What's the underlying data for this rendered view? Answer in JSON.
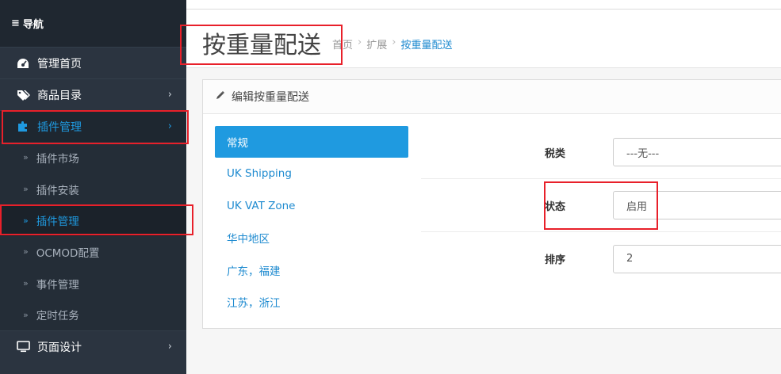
{
  "sidebar": {
    "nav_title": "导航",
    "items": [
      {
        "label": "管理首页",
        "icon": "dashboard-icon"
      },
      {
        "label": "商品目录",
        "icon": "tags-icon"
      },
      {
        "label": "插件管理",
        "icon": "puzzle-icon"
      }
    ],
    "sub_items": [
      {
        "label": "插件市场"
      },
      {
        "label": "插件安装"
      },
      {
        "label": "插件管理"
      },
      {
        "label": "OCMOD配置"
      },
      {
        "label": "事件管理"
      },
      {
        "label": "定时任务"
      }
    ],
    "bottom_item": {
      "label": "页面设计",
      "icon": "monitor-icon"
    }
  },
  "header": {
    "title": "按重量配送",
    "breadcrumb": [
      "首页",
      "扩展",
      "按重量配送"
    ]
  },
  "panel": {
    "title": "编辑按重量配送",
    "tabs": [
      {
        "label": "常规"
      },
      {
        "label": "UK Shipping"
      },
      {
        "label": "UK VAT Zone"
      },
      {
        "label": "华中地区"
      },
      {
        "label": "广东，福建"
      },
      {
        "label": "江苏，浙江"
      }
    ],
    "fields": [
      {
        "label": "税类",
        "value": "---无---"
      },
      {
        "label": "状态",
        "value": "启用"
      },
      {
        "label": "排序",
        "value": "2"
      }
    ]
  },
  "colors": {
    "accent": "#1f9ae0",
    "sidebar_bg": "#2b3440",
    "highlight": "#e8202a"
  }
}
